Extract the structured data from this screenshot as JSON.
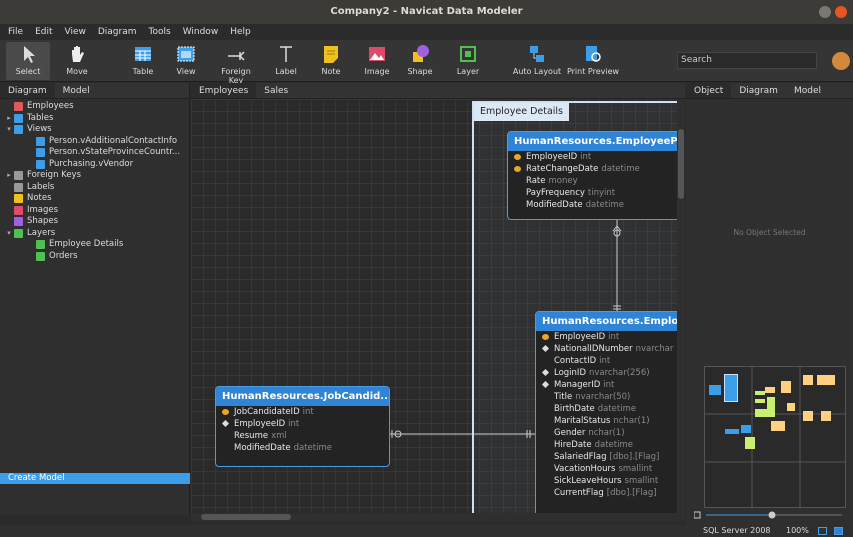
{
  "window": {
    "title": "Company2 - Navicat Data Modeler"
  },
  "menu": [
    "File",
    "Edit",
    "View",
    "Diagram",
    "Tools",
    "Window",
    "Help"
  ],
  "toolbar": [
    {
      "label": "Select",
      "icon": "cursor-icon"
    },
    {
      "label": "Move",
      "icon": "hand-icon"
    },
    {
      "label": "Table",
      "icon": "table-icon"
    },
    {
      "label": "View",
      "icon": "view-icon"
    },
    {
      "label": "Foreign Key",
      "icon": "foreign-key-icon"
    },
    {
      "label": "Label",
      "icon": "label-icon"
    },
    {
      "label": "Note",
      "icon": "note-icon"
    },
    {
      "label": "Image",
      "icon": "image-icon"
    },
    {
      "label": "Shape",
      "icon": "shape-icon"
    },
    {
      "label": "Layer",
      "icon": "layer-icon"
    },
    {
      "label": "Auto Layout",
      "icon": "auto-layout-icon"
    },
    {
      "label": "Print Preview",
      "icon": "print-preview-icon"
    }
  ],
  "search": {
    "placeholder": "Search"
  },
  "left_panel": {
    "tabs": [
      "Diagram",
      "Model"
    ],
    "tree": [
      {
        "label": "Employees",
        "arrow": "",
        "icon_color": "#e05a5a",
        "indent": 0
      },
      {
        "label": "Tables",
        "arrow": "▸",
        "icon_color": "#3c9ee8",
        "indent": 0
      },
      {
        "label": "Views",
        "arrow": "▾",
        "icon_color": "#3c9ee8",
        "indent": 0
      },
      {
        "label": "Person.vAdditionalContactInfo",
        "arrow": "",
        "icon_color": "#3c9ee8",
        "indent": 1
      },
      {
        "label": "Person.vStateProvinceCountr...",
        "arrow": "",
        "icon_color": "#3c9ee8",
        "indent": 1
      },
      {
        "label": "Purchasing.vVendor",
        "arrow": "",
        "icon_color": "#3c9ee8",
        "indent": 1
      },
      {
        "label": "Foreign Keys",
        "arrow": "▸",
        "icon_color": "#999999",
        "indent": 0
      },
      {
        "label": "Labels",
        "arrow": "",
        "icon_color": "#999999",
        "indent": 0
      },
      {
        "label": "Notes",
        "arrow": "",
        "icon_color": "#f0c020",
        "indent": 0
      },
      {
        "label": "Images",
        "arrow": "",
        "icon_color": "#e04a6a",
        "indent": 0
      },
      {
        "label": "Shapes",
        "arrow": "",
        "icon_color": "#a060e0",
        "indent": 0
      },
      {
        "label": "Layers",
        "arrow": "▾",
        "icon_color": "#50c050",
        "indent": 0
      },
      {
        "label": "Employee Details",
        "arrow": "",
        "icon_color": "#50c050",
        "indent": 1
      },
      {
        "label": "Orders",
        "arrow": "",
        "icon_color": "#50c050",
        "indent": 1
      }
    ],
    "create_model": "Create Model"
  },
  "canvas_tabs": [
    "Employees",
    "Sales"
  ],
  "layer": {
    "title": "Employee Details"
  },
  "entities": {
    "pay": {
      "name": "HumanResources.EmployeeP",
      "fields": [
        {
          "name": "EmployeeID",
          "type": "int",
          "mark": "key"
        },
        {
          "name": "RateChangeDate",
          "type": "datetime",
          "mark": "key"
        },
        {
          "name": "Rate",
          "type": "money",
          "mark": ""
        },
        {
          "name": "PayFrequency",
          "type": "tinyint",
          "mark": ""
        },
        {
          "name": "ModifiedDate",
          "type": "datetime",
          "mark": ""
        }
      ]
    },
    "emp": {
      "name": "HumanResources.Emplo",
      "fields": [
        {
          "name": "EmployeeID",
          "type": "int",
          "mark": "key"
        },
        {
          "name": "NationalIDNumber",
          "type": "nvarchar",
          "mark": "dia"
        },
        {
          "name": "ContactID",
          "type": "int",
          "mark": ""
        },
        {
          "name": "LoginID",
          "type": "nvarchar(256)",
          "mark": "dia"
        },
        {
          "name": "ManagerID",
          "type": "int",
          "mark": "dia"
        },
        {
          "name": "Title",
          "type": "nvarchar(50)",
          "mark": ""
        },
        {
          "name": "BirthDate",
          "type": "datetime",
          "mark": ""
        },
        {
          "name": "MaritalStatus",
          "type": "nchar(1)",
          "mark": ""
        },
        {
          "name": "Gender",
          "type": "nchar(1)",
          "mark": ""
        },
        {
          "name": "HireDate",
          "type": "datetime",
          "mark": ""
        },
        {
          "name": "SalariedFlag",
          "type": "[dbo].[Flag]",
          "mark": ""
        },
        {
          "name": "VacationHours",
          "type": "smallint",
          "mark": ""
        },
        {
          "name": "SickLeaveHours",
          "type": "smallint",
          "mark": ""
        },
        {
          "name": "CurrentFlag",
          "type": "[dbo].[Flag]",
          "mark": ""
        }
      ]
    },
    "job": {
      "name": "HumanResources.JobCandid...",
      "fields": [
        {
          "name": "JobCandidateID",
          "type": "int",
          "mark": "key"
        },
        {
          "name": "EmployeeID",
          "type": "int",
          "mark": "dia"
        },
        {
          "name": "Resume",
          "type": "xml",
          "mark": ""
        },
        {
          "name": "ModifiedDate",
          "type": "datetime",
          "mark": ""
        }
      ]
    }
  },
  "right_panel": {
    "tabs": [
      "Object",
      "Diagram",
      "Model"
    ],
    "empty_text": "No Object Selected"
  },
  "status": {
    "db": "SQL Server 2008",
    "zoom": "100%"
  },
  "colors": {
    "accent": "#3c9ee8",
    "entity_header": "#2f84d6",
    "canvas": "#2a2a2a"
  }
}
